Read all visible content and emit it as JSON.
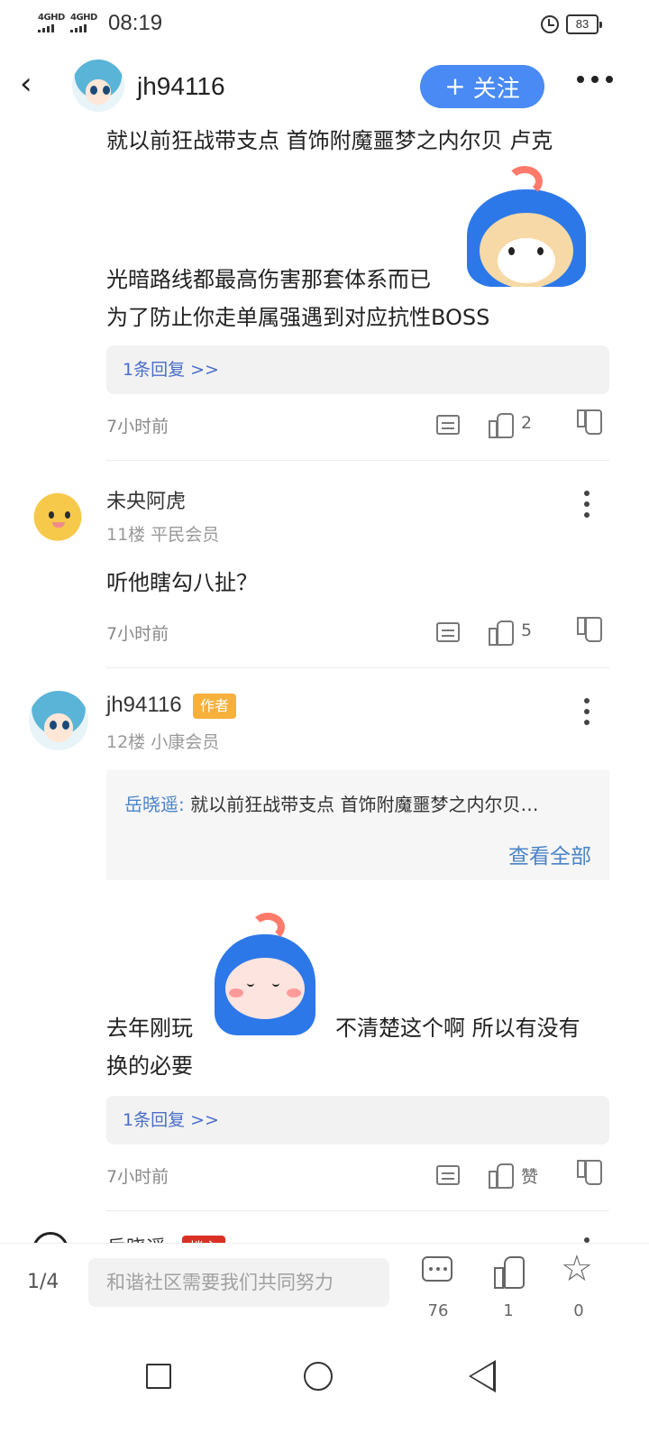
{
  "status_bar": {
    "signal_1": "4GHD",
    "signal_2": "4GHD",
    "time": "08:19",
    "battery": "83"
  },
  "header": {
    "back_icon": "chevron-left-icon",
    "username": "jh94116",
    "follow_plus": "+",
    "follow_label": "关注",
    "more_icon": "more-horizontal-icon"
  },
  "post_fragment": {
    "line1": "就以前狂战带支点 首饰附魔噩梦之内尔贝 卢克",
    "line2": "光暗路线都最高伤害那套体系而已",
    "line3": "为了防止你走单属强遇到对应抗性BOSS",
    "reply_link": "1条回复 >>",
    "time": "7小时前",
    "like_count": "2"
  },
  "comments": [
    {
      "name": "未央阿虎",
      "meta": "11楼 平民会员",
      "text": "听他瞎勾八扯？",
      "time": "7小时前",
      "like_count": "5"
    },
    {
      "name": "jh94116",
      "badge": "作者",
      "meta": "12楼 小康会员",
      "quote_author": "岳晓遥:",
      "quote_text": "就以前狂战带支点 首饰附魔噩梦之内尔贝…",
      "quote_more": "查看全部",
      "text_before": "去年刚玩",
      "text_after": "不清楚这个啊 所以有没有",
      "text_line2": "换的必要",
      "reply_link": "1条回复 >>",
      "time": "7小时前",
      "like_label": "赞"
    },
    {
      "name": "岳晓遥",
      "badge": "楼主"
    }
  ],
  "bottom_bar": {
    "page_indicator": "1/4",
    "input_placeholder": "和谐社区需要我们共同努力",
    "comment_count": "76",
    "like_count": "1",
    "favorite_count": "0"
  },
  "colors": {
    "accent": "#4a8af4",
    "link": "#4a6ec8",
    "author_badge": "#f6b03c",
    "op_badge": "#d93025"
  }
}
